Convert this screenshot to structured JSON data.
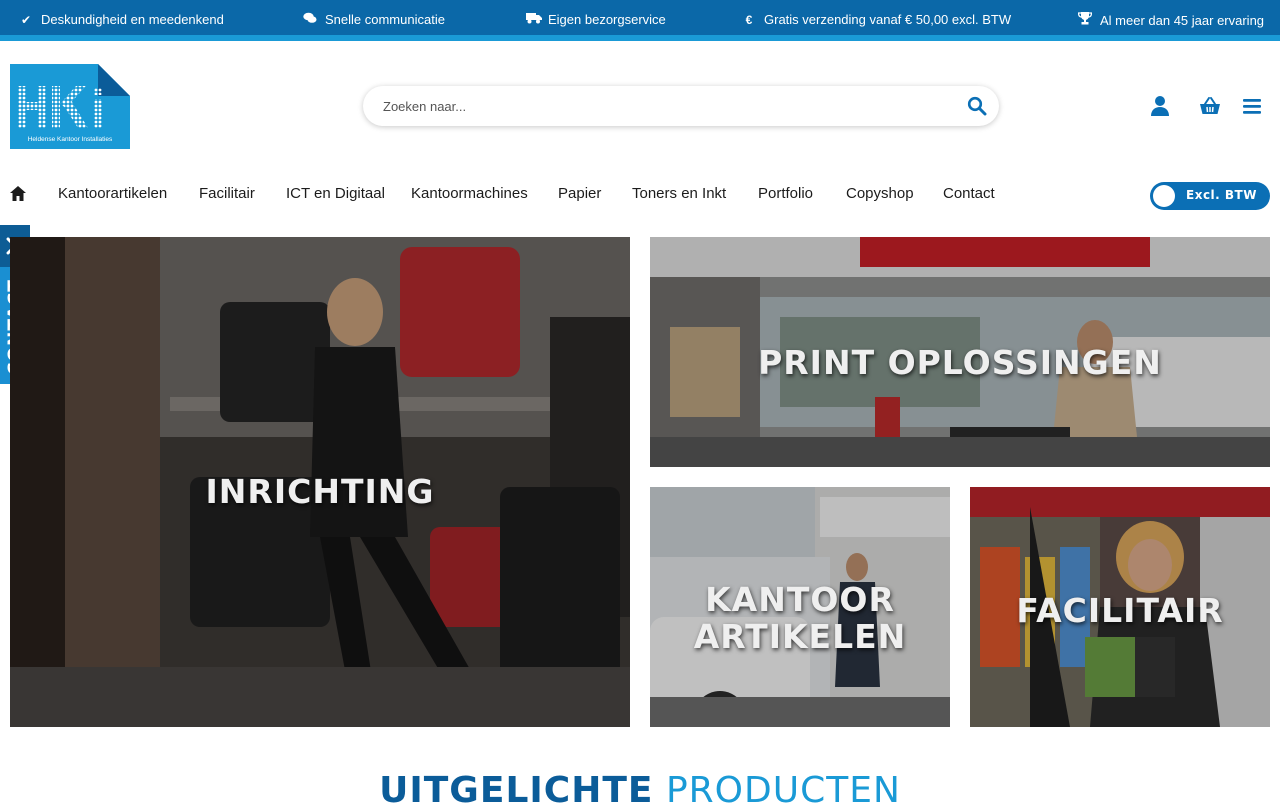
{
  "topbar": {
    "usps": [
      {
        "icon": "check-icon",
        "text": "Deskundigheid en meedenkend"
      },
      {
        "icon": "chat-icon",
        "text": "Snelle communicatie"
      },
      {
        "icon": "truck-icon",
        "text": "Eigen bezorgservice"
      },
      {
        "icon": "euro-icon",
        "text": "Gratis verzending vanaf € 50,00 excl. BTW"
      },
      {
        "icon": "trophy-icon",
        "text": "Al meer dan 45 jaar ervaring"
      }
    ]
  },
  "logo": {
    "letters": "HKi",
    "tagline": "Heldense Kantoor Installaties"
  },
  "search": {
    "placeholder": "Zoeken naar..."
  },
  "header_icons": [
    "user-icon",
    "basket-icon",
    "menu-icon"
  ],
  "nav": {
    "items": [
      "Kantoorartikelen",
      "Facilitair",
      "ICT en Digitaal",
      "Kantoormachines",
      "Papier",
      "Toners en Inkt",
      "Portfolio",
      "Copyshop",
      "Contact"
    ]
  },
  "vat_toggle": {
    "label": "Excl. BTW"
  },
  "side_tab": {
    "label": "CONTACT"
  },
  "tiles": [
    {
      "label": "INRICHTING"
    },
    {
      "label": "PRINT OPLOSSINGEN"
    },
    {
      "label_line1": "KANTOOR",
      "label_line2": "ARTIKELEN"
    },
    {
      "label": "FACILITAIR"
    }
  ],
  "featured": {
    "part1": "UITGELICHTE",
    "part2": "PRODUCTEN"
  },
  "colors": {
    "brand_dark": "#0b68a8",
    "brand_light": "#1a9ad6",
    "accent": "#0b6fb5"
  }
}
